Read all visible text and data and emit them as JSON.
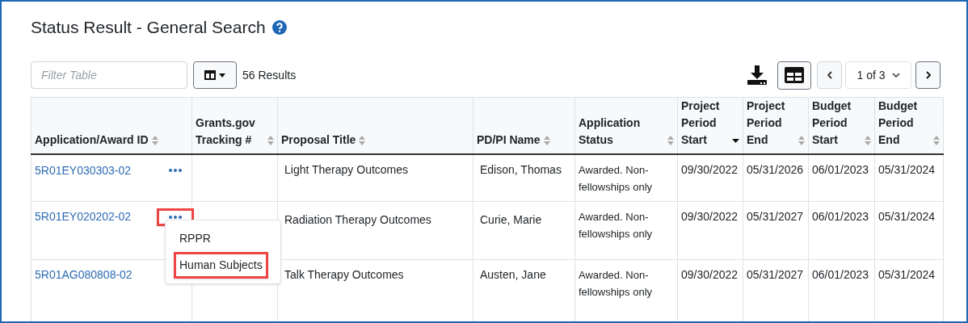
{
  "title": "Status Result - General Search",
  "toolbar": {
    "filter_placeholder": "Filter Table",
    "results": "56 Results",
    "page": "1 of 3"
  },
  "columns": [
    {
      "label": "Application/Award ID",
      "sorted_descending": false
    },
    {
      "label": "Grants.gov Tracking #",
      "sorted_descending": false
    },
    {
      "label": "Proposal Title",
      "sorted_descending": false
    },
    {
      "label": "PD/PI Name",
      "sorted_descending": false
    },
    {
      "label": "Application Status",
      "sorted_descending": false
    },
    {
      "label": "Project Period Start",
      "sorted_descending": true
    },
    {
      "label": "Project Period End",
      "sorted_descending": false
    },
    {
      "label": "Budget Period Start",
      "sorted_descending": false
    },
    {
      "label": "Budget Period End",
      "sorted_descending": false
    }
  ],
  "rows": [
    {
      "id": "5R01EY030303-02",
      "actions_highlighted": false,
      "menu_open": false,
      "cells": [
        "",
        "Light Therapy Outcomes",
        "Edison, Thomas",
        "Awarded. Non-fellowships only",
        "09/30/2022",
        "05/31/2026",
        "06/01/2023",
        "05/31/2024"
      ]
    },
    {
      "id": "5R01EY020202-02",
      "actions_highlighted": true,
      "menu_open": true,
      "cells": [
        "",
        "Radiation Therapy Outcomes",
        "Curie, Marie",
        "Awarded. Non-fellowships only",
        "09/30/2022",
        "05/31/2027",
        "06/01/2023",
        "05/31/2024"
      ]
    },
    {
      "id": "5R01AG080808-02",
      "menu_open": false,
      "cells": [
        "",
        "Talk Therapy Outcomes",
        "Austen, Jane",
        "Awarded. Non-fellowships only",
        "09/30/2022",
        "05/31/2027",
        "06/01/2023",
        "05/31/2024"
      ]
    }
  ],
  "menu": [
    {
      "label": "RPPR",
      "highlighted": false
    },
    {
      "label": "Human Subjects",
      "highlighted": true
    }
  ]
}
